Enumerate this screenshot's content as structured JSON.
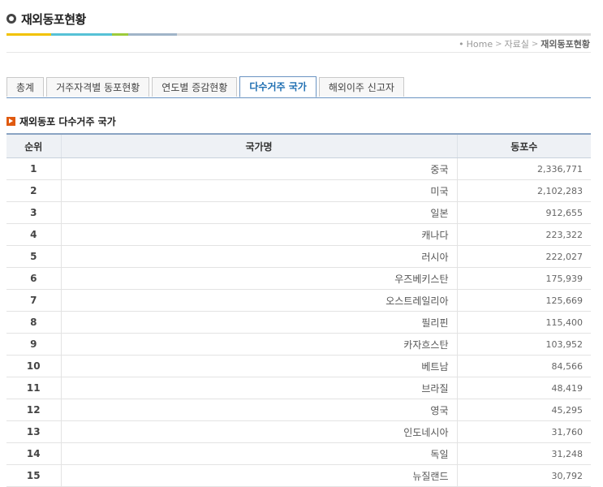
{
  "page": {
    "title": "재외동포현황",
    "accent_colors": [
      "#f2c200",
      "#56c1d6",
      "#9ccb3a",
      "#a0b4c8"
    ]
  },
  "breadcrumb": {
    "home": "Home",
    "level1": "자료실",
    "current": "재외동포현황"
  },
  "tabs": [
    {
      "label": "총계"
    },
    {
      "label": "거주자격별 동포현황"
    },
    {
      "label": "연도별 증감현황"
    },
    {
      "label": "다수거주 국가",
      "active": true
    },
    {
      "label": "해외이주 신고자"
    }
  ],
  "section": {
    "title": "재외동포 다수거주 국가"
  },
  "table": {
    "headers": [
      "순위",
      "국가명",
      "동포수"
    ],
    "rows": [
      {
        "rank": "1",
        "country": "중국",
        "count": "2,336,771"
      },
      {
        "rank": "2",
        "country": "미국",
        "count": "2,102,283"
      },
      {
        "rank": "3",
        "country": "일본",
        "count": "912,655"
      },
      {
        "rank": "4",
        "country": "캐나다",
        "count": "223,322"
      },
      {
        "rank": "5",
        "country": "러시아",
        "count": "222,027"
      },
      {
        "rank": "6",
        "country": "우즈베키스탄",
        "count": "175,939"
      },
      {
        "rank": "7",
        "country": "오스트레일리아",
        "count": "125,669"
      },
      {
        "rank": "8",
        "country": "필리핀",
        "count": "115,400"
      },
      {
        "rank": "9",
        "country": "카자흐스탄",
        "count": "103,952"
      },
      {
        "rank": "10",
        "country": "베트남",
        "count": "84,566"
      },
      {
        "rank": "11",
        "country": "브라질",
        "count": "48,419"
      },
      {
        "rank": "12",
        "country": "영국",
        "count": "45,295"
      },
      {
        "rank": "13",
        "country": "인도네시아",
        "count": "31,760"
      },
      {
        "rank": "14",
        "country": "독일",
        "count": "31,248"
      },
      {
        "rank": "15",
        "country": "뉴질랜드",
        "count": "30,792"
      }
    ]
  }
}
